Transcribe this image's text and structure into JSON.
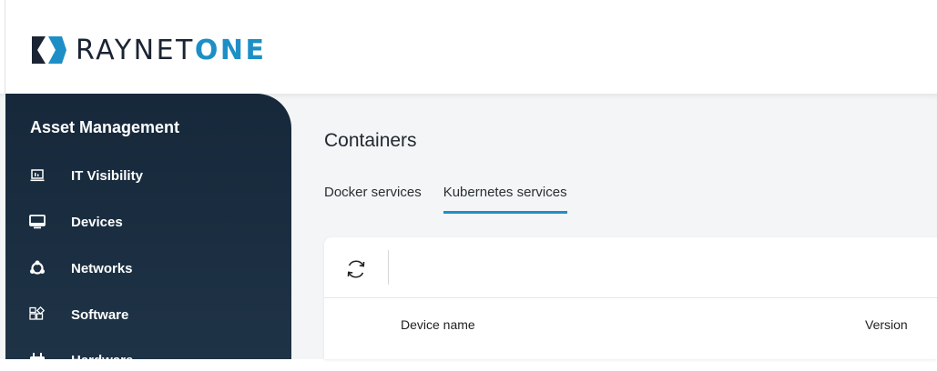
{
  "brand": {
    "name_plain": "RAYNET",
    "name_accent": "ONE",
    "colors": {
      "dark": "#1b2433",
      "accent": "#1e8fc6"
    }
  },
  "sidebar": {
    "title": "Asset Management",
    "items": [
      {
        "label": "IT Visibility",
        "icon": "it-visibility-icon"
      },
      {
        "label": "Devices",
        "icon": "monitor-icon"
      },
      {
        "label": "Networks",
        "icon": "network-icon"
      },
      {
        "label": "Software",
        "icon": "software-icon"
      },
      {
        "label": "Hardware",
        "icon": "hardware-icon"
      }
    ]
  },
  "main": {
    "title": "Containers",
    "tabs": [
      {
        "label": "Docker services",
        "active": false
      },
      {
        "label": "Kubernetes services",
        "active": true
      }
    ],
    "toolbar": {
      "refresh_icon": "refresh-icon"
    },
    "table": {
      "columns": [
        "Device name",
        "Version"
      ]
    }
  }
}
